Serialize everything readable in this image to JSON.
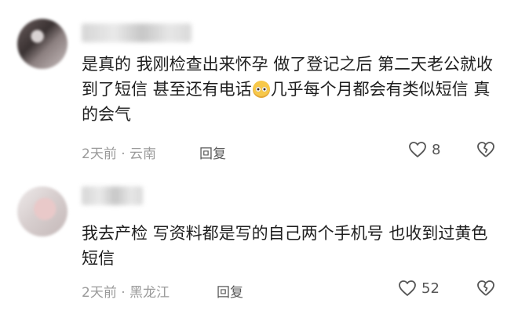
{
  "comments": [
    {
      "text_before": "是真的 我刚检查出来怀孕 做了登记之后 第二天老公就收到了短信 甚至还有电话",
      "emoji": "pleading-face-emoji",
      "text_after": "几乎每个月都会有类似短信 真的会气",
      "meta": "2天前 · 云南",
      "reply_label": "回复",
      "likes": "8"
    },
    {
      "text_before": "我去产检 写资料都是写的自己两个手机号 也收到过黄色短信",
      "meta": "2天前 · 黑龙江",
      "reply_label": "回复",
      "likes": "52"
    }
  ]
}
